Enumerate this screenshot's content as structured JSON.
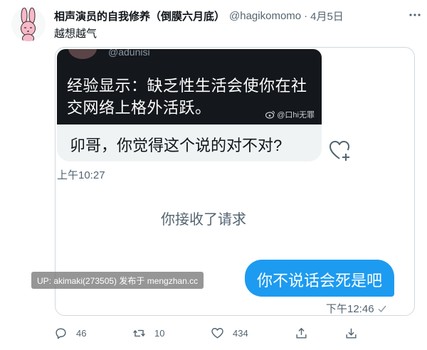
{
  "tweet": {
    "display_name": "相声演员的自我修养（倒膜六月底）",
    "handle": "@hagikomomo",
    "separator": "·",
    "date": "4月5日",
    "text": "越想越气"
  },
  "screenshot": {
    "dark_card": {
      "handle": "@adunisi",
      "text": "经验显示：缺乏性生活会使你在社交网络上格外活跃。",
      "weibo_watermark": "@口hi无罪"
    },
    "received_message": "卯哥，你觉得这个说的对不对?",
    "received_time": "上午10:27",
    "system_message": "你接收了请求",
    "sent_message": "你不说话会死是吧",
    "sent_time": "下午12:46"
  },
  "watermark": "UP: akimaki(273505) 发布于 mengzhan.cc",
  "actions": {
    "reply_count": "46",
    "retweet_count": "10",
    "like_count": "434"
  },
  "colors": {
    "accent": "#1d9bf0",
    "text_secondary": "#536471",
    "dark_card_bg": "#14171b",
    "bubble_gray": "#eff3f4",
    "avatar_pink": "#f6b9c8"
  },
  "icons": [
    "bunny-avatar",
    "more-icon",
    "heart-plus-icon",
    "check-icon",
    "reply-icon",
    "retweet-icon",
    "like-icon",
    "share-icon",
    "download-icon",
    "weibo-icon"
  ]
}
